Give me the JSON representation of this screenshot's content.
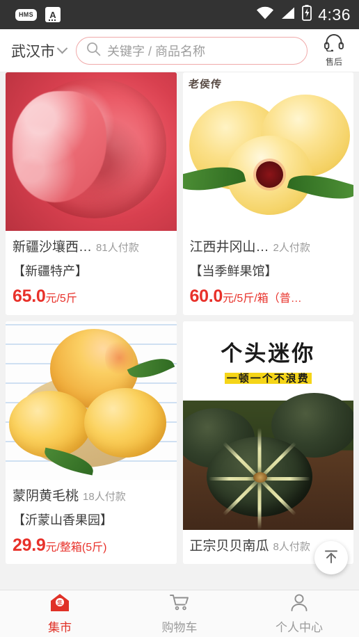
{
  "status_bar": {
    "app_badges": [
      "HMS",
      "A"
    ],
    "icons": [
      "wifi-icon",
      "signal-icon",
      "battery-charging-icon"
    ],
    "time": "4:36",
    "background": "#333333"
  },
  "header": {
    "city": "武汉市",
    "city_chevron": "chevron-down-icon",
    "search": {
      "icon": "search-icon",
      "placeholder": "关键字 / 商品名称",
      "value": "",
      "border_color": "#f0a9a9"
    },
    "service": {
      "icon": "headset-icon",
      "label": "售后"
    }
  },
  "products": [
    {
      "image": "watermelon-flesh-photo",
      "watermark": "",
      "title": "新疆沙壤西…",
      "buyers": "81人付款",
      "shop": "【新疆特产】",
      "price_number": "65.0",
      "price_unit": "元/5斤"
    },
    {
      "image": "yellow-peach-halves-photo",
      "watermark": "老侯传",
      "title": "江西井冈山…",
      "buyers": "2人付款",
      "shop": "【当季鲜果馆】",
      "price_number": "60.0",
      "price_unit": "元/5斤/箱（普…"
    },
    {
      "image": "yellow-peaches-basket-photo",
      "watermark": "",
      "title": "蒙阴黄毛桃",
      "buyers": "18人付款",
      "shop": "【沂蒙山香果园】",
      "price_number": "29.9",
      "price_unit": "元/整箱(5斤)"
    },
    {
      "image": "green-pumpkin-photo",
      "watermark": "",
      "promo_headline": "个头迷你",
      "promo_subline": "一顿一个不浪费",
      "title": "正宗贝贝南瓜",
      "buyers": "8人付款",
      "shop": "",
      "price_number": "",
      "price_unit": ""
    }
  ],
  "scroll_top_button": {
    "icon": "arrow-up-to-line-icon"
  },
  "tabbar": {
    "active_color": "#e03127",
    "inactive_color": "#9b9b9b",
    "items": [
      {
        "icon": "home-market-icon",
        "label": "集市",
        "active": true
      },
      {
        "icon": "shopping-cart-icon",
        "label": "购物车",
        "active": false
      },
      {
        "icon": "user-person-icon",
        "label": "个人中心",
        "active": false
      }
    ]
  }
}
